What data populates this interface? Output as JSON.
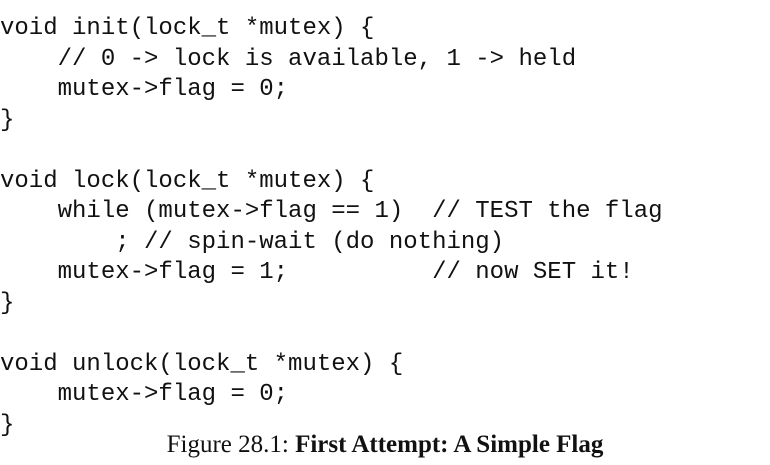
{
  "code": {
    "lines": [
      "void init(lock_t *mutex) {",
      "    // 0 -> lock is available, 1 -> held",
      "    mutex->flag = 0;",
      "}",
      "",
      "void lock(lock_t *mutex) {",
      "    while (mutex->flag == 1)  // TEST the flag",
      "        ; // spin-wait (do nothing)",
      "    mutex->flag = 1;          // now SET it!",
      "}",
      "",
      "void unlock(lock_t *mutex) {",
      "    mutex->flag = 0;",
      "}"
    ]
  },
  "caption": {
    "label": "Figure 28.1: ",
    "title": "First Attempt: A Simple Flag"
  }
}
